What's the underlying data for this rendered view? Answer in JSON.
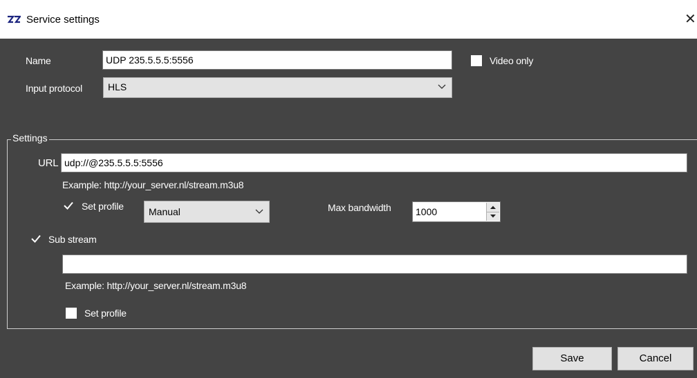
{
  "window": {
    "title": "Service settings",
    "close_glyph": "✕"
  },
  "form": {
    "name_label": "Name",
    "name_value": "UDP 235.5.5.5:5556",
    "video_only_label": "Video only",
    "video_only_checked": false,
    "input_protocol_label": "Input protocol",
    "input_protocol_value": "HLS"
  },
  "settings": {
    "group_title": "Settings",
    "url_label": "URL",
    "url_value": "udp://@235.5.5.5:5556",
    "url_example": "Example: http://your_server.nl/stream.m3u8",
    "set_profile_label": "Set profile",
    "set_profile_checked": true,
    "profile_value": "Manual",
    "max_bandwidth_label": "Max bandwidth",
    "max_bandwidth_value": "1000",
    "sub_stream_label": "Sub stream",
    "sub_stream_checked": true,
    "sub_stream_url_value": "",
    "sub_stream_example": "Example: http://your_server.nl/stream.m3u8",
    "sub_set_profile_label": "Set profile",
    "sub_set_profile_checked": false
  },
  "footer": {
    "save_label": "Save",
    "cancel_label": "Cancel"
  },
  "icons": {
    "app": "app-logo-icon",
    "close": "close-icon",
    "chevron": "chevron-down-icon",
    "check": "checkmark-icon",
    "spin_up": "spin-up-icon",
    "spin_down": "spin-down-icon"
  }
}
